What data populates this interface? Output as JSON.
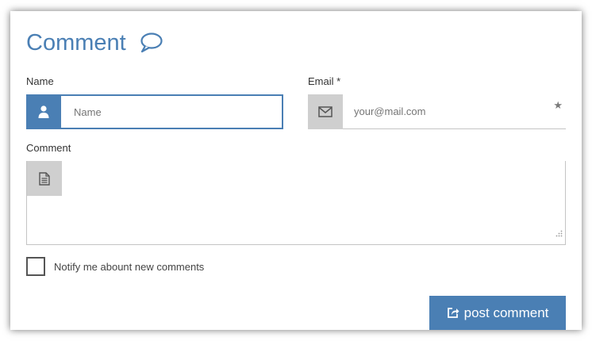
{
  "form": {
    "title": "Comment",
    "icons": {
      "title": "speech-bubble-icon",
      "name": "user-icon",
      "email": "envelope-icon",
      "comment": "document-icon",
      "required": "star-icon",
      "submit": "share-icon"
    },
    "name": {
      "label": "Name",
      "placeholder": "Name"
    },
    "email": {
      "label": "Email *",
      "placeholder": "your@mail.com"
    },
    "comment": {
      "label": "Comment"
    },
    "notify": {
      "label": "Notify me abount new comments",
      "checked": false
    },
    "submit": {
      "label": "post comment"
    }
  },
  "colors": {
    "accent": "#4a7fb4",
    "icon_bg_inactive": "#cfcfcf",
    "border": "#c4c4c4"
  }
}
